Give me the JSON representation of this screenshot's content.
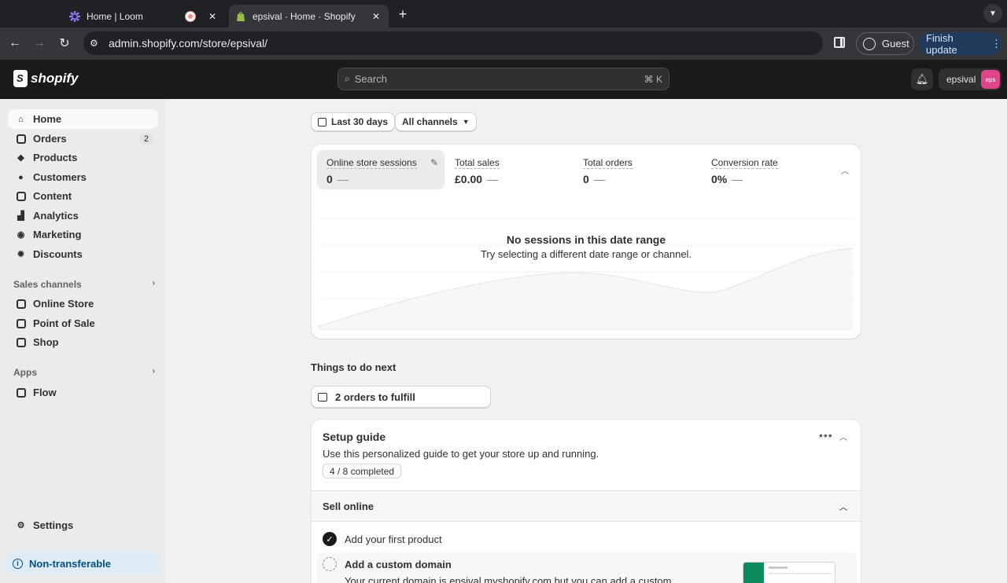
{
  "browser": {
    "tabs": [
      {
        "title": "Home | Loom",
        "active": false
      },
      {
        "title": "epsival · Home · Shopify",
        "active": true
      }
    ],
    "url": "admin.shopify.com/store/epsival/",
    "profile_label": "Guest",
    "update_label": "Finish update"
  },
  "topbar": {
    "logo_text": "shopify",
    "search_placeholder": "Search",
    "search_shortcut": "⌘ K",
    "store_name": "epsival",
    "avatar_text": "eps"
  },
  "sidebar": {
    "items": [
      {
        "label": "Home",
        "icon": "home-icon"
      },
      {
        "label": "Orders",
        "icon": "orders-icon",
        "badge": "2"
      },
      {
        "label": "Products",
        "icon": "tag-icon"
      },
      {
        "label": "Customers",
        "icon": "person-icon"
      },
      {
        "label": "Content",
        "icon": "content-icon"
      },
      {
        "label": "Analytics",
        "icon": "bar-chart-icon"
      },
      {
        "label": "Marketing",
        "icon": "target-icon"
      },
      {
        "label": "Discounts",
        "icon": "discount-icon"
      }
    ],
    "sales_channels_title": "Sales channels",
    "channels": [
      {
        "label": "Online Store"
      },
      {
        "label": "Point of Sale"
      },
      {
        "label": "Shop"
      }
    ],
    "apps_title": "Apps",
    "apps": [
      {
        "label": "Flow"
      }
    ],
    "settings_label": "Settings",
    "non_transferable_label": "Non-transferable"
  },
  "filters": {
    "date_range": "Last 30 days",
    "channels": "All channels"
  },
  "metrics": [
    {
      "label": "Online store sessions",
      "value": "0",
      "change": "—"
    },
    {
      "label": "Total sales",
      "value": "£0.00",
      "change": "—"
    },
    {
      "label": "Total orders",
      "value": "0",
      "change": "—"
    },
    {
      "label": "Conversion rate",
      "value": "0%",
      "change": "—"
    }
  ],
  "empty_state": {
    "title": "No sessions in this date range",
    "subtitle": "Try selecting a different date range or channel."
  },
  "things_to_do": {
    "title": "Things to do next",
    "orders_button": "2 orders to fulfill"
  },
  "setup_guide": {
    "title": "Setup guide",
    "description": "Use this personalized guide to get your store up and running.",
    "progress": "4 / 8 completed",
    "section_title": "Sell online",
    "tasks": [
      {
        "label": "Add your first product",
        "done": true
      },
      {
        "label": "Add a custom domain",
        "done": false,
        "description": "Your current domain is epsival.myshopify.com but you can add a custom"
      }
    ]
  }
}
